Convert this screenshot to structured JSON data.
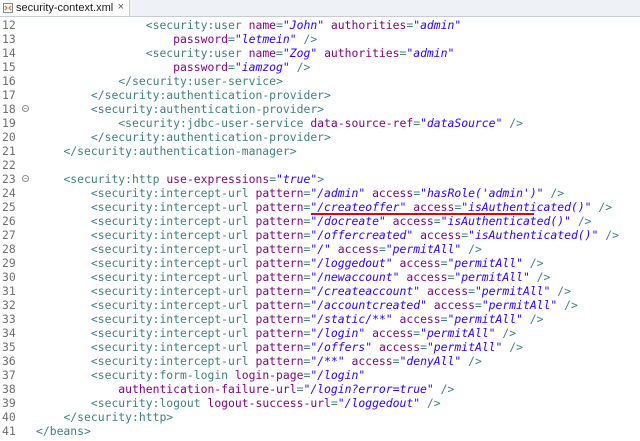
{
  "tab": {
    "title": "security-context.xml",
    "close": "×"
  },
  "lines": [
    {
      "n": "12",
      "fold": false,
      "indent": 16,
      "parts": [
        {
          "k": "tag",
          "t": "<security:user "
        },
        {
          "k": "attr",
          "t": "name"
        },
        {
          "k": "tag",
          "t": "="
        },
        {
          "k": "val",
          "t": "\"John\""
        },
        {
          "k": "tag",
          "t": " "
        },
        {
          "k": "attr",
          "t": "authorities"
        },
        {
          "k": "tag",
          "t": "="
        },
        {
          "k": "val",
          "t": "\"admin\""
        }
      ]
    },
    {
      "n": "13",
      "fold": false,
      "indent": 20,
      "parts": [
        {
          "k": "attr",
          "t": "password"
        },
        {
          "k": "tag",
          "t": "="
        },
        {
          "k": "val",
          "t": "\"letmein\""
        },
        {
          "k": "tag",
          "t": " />"
        }
      ]
    },
    {
      "n": "14",
      "fold": false,
      "indent": 16,
      "parts": [
        {
          "k": "tag",
          "t": "<security:user "
        },
        {
          "k": "attr",
          "t": "name"
        },
        {
          "k": "tag",
          "t": "="
        },
        {
          "k": "val",
          "t": "\"Zog\""
        },
        {
          "k": "tag",
          "t": " "
        },
        {
          "k": "attr",
          "t": "authorities"
        },
        {
          "k": "tag",
          "t": "="
        },
        {
          "k": "val",
          "t": "\"admin\""
        }
      ]
    },
    {
      "n": "15",
      "fold": false,
      "indent": 20,
      "parts": [
        {
          "k": "attr",
          "t": "password"
        },
        {
          "k": "tag",
          "t": "="
        },
        {
          "k": "val",
          "t": "\"iamzog\""
        },
        {
          "k": "tag",
          "t": " />"
        }
      ]
    },
    {
      "n": "16",
      "fold": false,
      "indent": 12,
      "parts": [
        {
          "k": "tag",
          "t": "</security:user-service>"
        }
      ]
    },
    {
      "n": "17",
      "fold": false,
      "indent": 8,
      "parts": [
        {
          "k": "tag",
          "t": "</security:authentication-provider>"
        }
      ]
    },
    {
      "n": "18",
      "fold": true,
      "indent": 8,
      "parts": [
        {
          "k": "tag",
          "t": "<security:authentication-provider>"
        }
      ]
    },
    {
      "n": "19",
      "fold": false,
      "indent": 12,
      "parts": [
        {
          "k": "tag",
          "t": "<security:jdbc-user-service "
        },
        {
          "k": "attr",
          "t": "data-source-ref"
        },
        {
          "k": "tag",
          "t": "="
        },
        {
          "k": "val",
          "t": "\"dataSource\""
        },
        {
          "k": "tag",
          "t": " />"
        }
      ]
    },
    {
      "n": "20",
      "fold": false,
      "indent": 8,
      "parts": [
        {
          "k": "tag",
          "t": "</security:authentication-provider>"
        }
      ]
    },
    {
      "n": "21",
      "fold": false,
      "indent": 4,
      "parts": [
        {
          "k": "tag",
          "t": "</security:authentication-manager>"
        }
      ]
    },
    {
      "n": "22",
      "fold": false,
      "indent": 0,
      "parts": []
    },
    {
      "n": "23",
      "fold": true,
      "indent": 4,
      "parts": [
        {
          "k": "tag",
          "t": "<security:http "
        },
        {
          "k": "attr",
          "t": "use-expressions"
        },
        {
          "k": "tag",
          "t": "="
        },
        {
          "k": "val",
          "t": "\"true\""
        },
        {
          "k": "tag",
          "t": ">"
        }
      ]
    },
    {
      "n": "24",
      "fold": false,
      "indent": 8,
      "parts": [
        {
          "k": "tag",
          "t": "<security:intercept-url "
        },
        {
          "k": "attr",
          "t": "pattern"
        },
        {
          "k": "tag",
          "t": "="
        },
        {
          "k": "val",
          "t": "\"/admin\""
        },
        {
          "k": "tag",
          "t": " "
        },
        {
          "k": "attr",
          "t": "access"
        },
        {
          "k": "tag",
          "t": "="
        },
        {
          "k": "val",
          "t": "\"hasRole('admin')\""
        },
        {
          "k": "tag",
          "t": " />"
        }
      ]
    },
    {
      "n": "25",
      "fold": false,
      "indent": 8,
      "parts": [
        {
          "k": "tag",
          "t": "<security:intercept-url "
        },
        {
          "k": "attr",
          "t": "pattern"
        },
        {
          "k": "tag",
          "t": "="
        },
        {
          "k": "val",
          "t": "\"/createoffer\""
        },
        {
          "k": "tag",
          "t": " "
        },
        {
          "k": "attr",
          "t": "access"
        },
        {
          "k": "tag",
          "t": "="
        },
        {
          "k": "val",
          "t": "\"isAuthenticated()\""
        },
        {
          "k": "tag",
          "t": " />"
        }
      ]
    },
    {
      "n": "26",
      "fold": false,
      "indent": 8,
      "parts": [
        {
          "k": "tag",
          "t": "<security:intercept-url "
        },
        {
          "k": "attr",
          "t": "pattern"
        },
        {
          "k": "tag",
          "t": "="
        },
        {
          "k": "val",
          "t": "\"/docreate\""
        },
        {
          "k": "tag",
          "t": " "
        },
        {
          "k": "attr",
          "t": "access"
        },
        {
          "k": "tag",
          "t": "="
        },
        {
          "k": "val",
          "t": "\"isAuthenticated()\""
        },
        {
          "k": "tag",
          "t": " />"
        }
      ]
    },
    {
      "n": "27",
      "fold": false,
      "indent": 8,
      "parts": [
        {
          "k": "tag",
          "t": "<security:intercept-url "
        },
        {
          "k": "attr",
          "t": "pattern"
        },
        {
          "k": "tag",
          "t": "="
        },
        {
          "k": "val",
          "t": "\"/offercreated\""
        },
        {
          "k": "tag",
          "t": " "
        },
        {
          "k": "attr",
          "t": "access"
        },
        {
          "k": "tag",
          "t": "="
        },
        {
          "k": "val",
          "t": "\"isAuthenticated()\""
        },
        {
          "k": "tag",
          "t": " />"
        }
      ]
    },
    {
      "n": "28",
      "fold": false,
      "indent": 8,
      "parts": [
        {
          "k": "tag",
          "t": "<security:intercept-url "
        },
        {
          "k": "attr",
          "t": "pattern"
        },
        {
          "k": "tag",
          "t": "="
        },
        {
          "k": "val",
          "t": "\"/\""
        },
        {
          "k": "tag",
          "t": " "
        },
        {
          "k": "attr",
          "t": "access"
        },
        {
          "k": "tag",
          "t": "="
        },
        {
          "k": "val",
          "t": "\"permitAll\""
        },
        {
          "k": "tag",
          "t": " />"
        }
      ]
    },
    {
      "n": "29",
      "fold": false,
      "indent": 8,
      "parts": [
        {
          "k": "tag",
          "t": "<security:intercept-url "
        },
        {
          "k": "attr",
          "t": "pattern"
        },
        {
          "k": "tag",
          "t": "="
        },
        {
          "k": "val",
          "t": "\"/loggedout\""
        },
        {
          "k": "tag",
          "t": " "
        },
        {
          "k": "attr",
          "t": "access"
        },
        {
          "k": "tag",
          "t": "="
        },
        {
          "k": "val",
          "t": "\"permitAll\""
        },
        {
          "k": "tag",
          "t": " />"
        }
      ]
    },
    {
      "n": "30",
      "fold": false,
      "indent": 8,
      "parts": [
        {
          "k": "tag",
          "t": "<security:intercept-url "
        },
        {
          "k": "attr",
          "t": "pattern"
        },
        {
          "k": "tag",
          "t": "="
        },
        {
          "k": "val",
          "t": "\"/newaccount\""
        },
        {
          "k": "tag",
          "t": " "
        },
        {
          "k": "attr",
          "t": "access"
        },
        {
          "k": "tag",
          "t": "="
        },
        {
          "k": "val",
          "t": "\"permitAll\""
        },
        {
          "k": "tag",
          "t": " />"
        }
      ]
    },
    {
      "n": "31",
      "fold": false,
      "indent": 8,
      "parts": [
        {
          "k": "tag",
          "t": "<security:intercept-url "
        },
        {
          "k": "attr",
          "t": "pattern"
        },
        {
          "k": "tag",
          "t": "="
        },
        {
          "k": "val",
          "t": "\"/createaccount\""
        },
        {
          "k": "tag",
          "t": " "
        },
        {
          "k": "attr",
          "t": "access"
        },
        {
          "k": "tag",
          "t": "="
        },
        {
          "k": "val",
          "t": "\"permitAll\""
        },
        {
          "k": "tag",
          "t": " />"
        }
      ]
    },
    {
      "n": "32",
      "fold": false,
      "indent": 8,
      "parts": [
        {
          "k": "tag",
          "t": "<security:intercept-url "
        },
        {
          "k": "attr",
          "t": "pattern"
        },
        {
          "k": "tag",
          "t": "="
        },
        {
          "k": "val",
          "t": "\"/accountcreated\""
        },
        {
          "k": "tag",
          "t": " "
        },
        {
          "k": "attr",
          "t": "access"
        },
        {
          "k": "tag",
          "t": "="
        },
        {
          "k": "val",
          "t": "\"permitAll\""
        },
        {
          "k": "tag",
          "t": " />"
        }
      ]
    },
    {
      "n": "33",
      "fold": false,
      "indent": 8,
      "parts": [
        {
          "k": "tag",
          "t": "<security:intercept-url "
        },
        {
          "k": "attr",
          "t": "pattern"
        },
        {
          "k": "tag",
          "t": "="
        },
        {
          "k": "val",
          "t": "\"/static/**\""
        },
        {
          "k": "tag",
          "t": " "
        },
        {
          "k": "attr",
          "t": "access"
        },
        {
          "k": "tag",
          "t": "="
        },
        {
          "k": "val",
          "t": "\"permitAll\""
        },
        {
          "k": "tag",
          "t": " />"
        }
      ]
    },
    {
      "n": "34",
      "fold": false,
      "indent": 8,
      "parts": [
        {
          "k": "tag",
          "t": "<security:intercept-url "
        },
        {
          "k": "attr",
          "t": "pattern"
        },
        {
          "k": "tag",
          "t": "="
        },
        {
          "k": "val",
          "t": "\"/login\""
        },
        {
          "k": "tag",
          "t": " "
        },
        {
          "k": "attr",
          "t": "access"
        },
        {
          "k": "tag",
          "t": "="
        },
        {
          "k": "val",
          "t": "\"permitAll\""
        },
        {
          "k": "tag",
          "t": " />"
        }
      ]
    },
    {
      "n": "35",
      "fold": false,
      "indent": 8,
      "parts": [
        {
          "k": "tag",
          "t": "<security:intercept-url "
        },
        {
          "k": "attr",
          "t": "pattern"
        },
        {
          "k": "tag",
          "t": "="
        },
        {
          "k": "val",
          "t": "\"/offers\""
        },
        {
          "k": "tag",
          "t": " "
        },
        {
          "k": "attr",
          "t": "access"
        },
        {
          "k": "tag",
          "t": "="
        },
        {
          "k": "val",
          "t": "\"permitAll\""
        },
        {
          "k": "tag",
          "t": " />"
        }
      ]
    },
    {
      "n": "36",
      "fold": false,
      "indent": 8,
      "parts": [
        {
          "k": "tag",
          "t": "<security:intercept-url "
        },
        {
          "k": "attr",
          "t": "pattern"
        },
        {
          "k": "tag",
          "t": "="
        },
        {
          "k": "val",
          "t": "\"/**\""
        },
        {
          "k": "tag",
          "t": " "
        },
        {
          "k": "attr",
          "t": "access"
        },
        {
          "k": "tag",
          "t": "="
        },
        {
          "k": "val",
          "t": "\"denyAll\""
        },
        {
          "k": "tag",
          "t": " />"
        }
      ]
    },
    {
      "n": "37",
      "fold": false,
      "indent": 8,
      "parts": [
        {
          "k": "tag",
          "t": "<security:form-login "
        },
        {
          "k": "attr",
          "t": "login-page"
        },
        {
          "k": "tag",
          "t": "="
        },
        {
          "k": "val",
          "t": "\"/login\""
        }
      ]
    },
    {
      "n": "38",
      "fold": false,
      "indent": 12,
      "parts": [
        {
          "k": "attr",
          "t": "authentication-failure-url"
        },
        {
          "k": "tag",
          "t": "="
        },
        {
          "k": "val",
          "t": "\"/login?error=true\""
        },
        {
          "k": "tag",
          "t": " />"
        }
      ]
    },
    {
      "n": "39",
      "fold": false,
      "indent": 8,
      "parts": [
        {
          "k": "tag",
          "t": "<security:logout "
        },
        {
          "k": "attr",
          "t": "logout-success-url"
        },
        {
          "k": "tag",
          "t": "="
        },
        {
          "k": "val",
          "t": "\"/loggedout\""
        },
        {
          "k": "tag",
          "t": " />"
        }
      ]
    },
    {
      "n": "40",
      "fold": false,
      "indent": 4,
      "parts": [
        {
          "k": "tag",
          "t": "</security:http>"
        }
      ]
    },
    {
      "n": "41",
      "fold": false,
      "indent": 0,
      "parts": [
        {
          "k": "tag",
          "t": "</beans>"
        }
      ]
    }
  ],
  "colors": {
    "tag": "#3f7f7f",
    "attr": "#7f007f",
    "value": "#2a00ff",
    "annotation": "#d20a0a"
  }
}
